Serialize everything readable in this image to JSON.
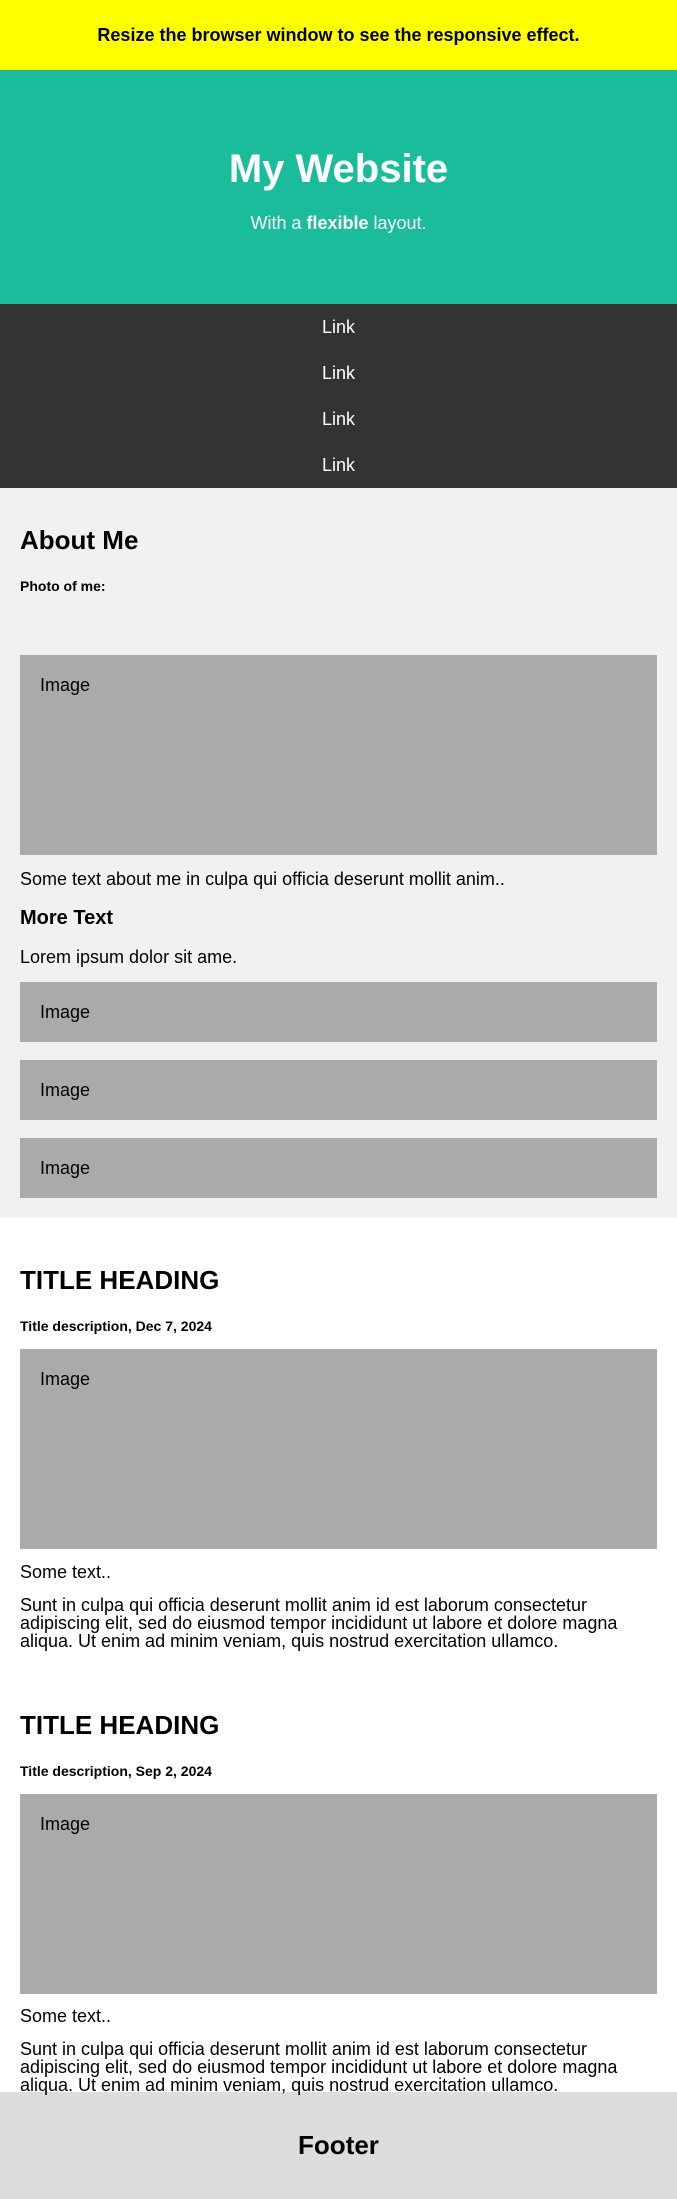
{
  "banner": {
    "text": "Resize the browser window to see the responsive effect."
  },
  "header": {
    "title": "My Website",
    "subtitle_prefix": "With a ",
    "subtitle_bold": "flexible",
    "subtitle_suffix": " layout."
  },
  "nav": {
    "links": [
      "Link",
      "Link",
      "Link",
      "Link"
    ]
  },
  "side": {
    "title": "About Me",
    "photo_label": "Photo of me:",
    "main_image": "Image",
    "about_text": "Some text about me in culpa qui officia deserunt mollit anim..",
    "more_title": "More Text",
    "more_text": "Lorem ipsum dolor sit ame.",
    "images": [
      "Image",
      "Image",
      "Image"
    ]
  },
  "posts": [
    {
      "title": "TITLE HEADING",
      "description": "Title description, Dec 7, 2024",
      "image": "Image",
      "short_text": "Some text..",
      "long_text": "Sunt in culpa qui officia deserunt mollit anim id est laborum consectetur adipiscing elit, sed do eiusmod tempor incididunt ut labore et dolore magna aliqua. Ut enim ad minim veniam, quis nostrud exercitation ullamco."
    },
    {
      "title": "TITLE HEADING",
      "description": "Title description, Sep 2, 2024",
      "image": "Image",
      "short_text": "Some text..",
      "long_text": "Sunt in culpa qui officia deserunt mollit anim id est laborum consectetur adipiscing elit, sed do eiusmod tempor incididunt ut labore et dolore magna aliqua. Ut enim ad minim veniam, quis nostrud exercitation ullamco."
    }
  ],
  "footer": {
    "title": "Footer"
  }
}
